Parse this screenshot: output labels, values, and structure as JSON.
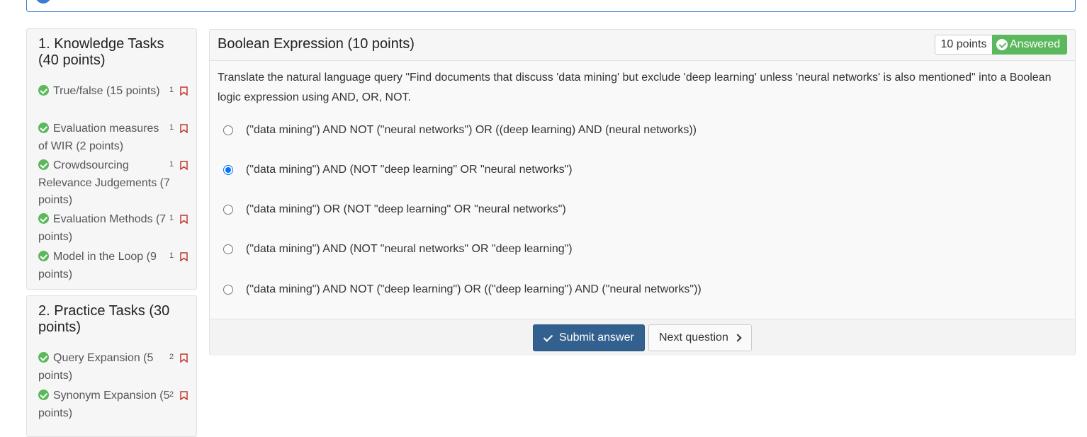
{
  "sidebar": {
    "sections": [
      {
        "title": "1. Knowledge Tasks (40 points)",
        "items": [
          {
            "label": "True/false (15 points)",
            "count": "1"
          },
          {
            "label": "Evaluation measures of WIR (2 points)",
            "count": "1"
          },
          {
            "label": "Crowdsourcing Relevance Judgements (7 points)",
            "count": "1"
          },
          {
            "label": "Evaluation Methods (7 points)",
            "count": "1"
          },
          {
            "label": "Model in the Loop (9 points)",
            "count": "1"
          }
        ]
      },
      {
        "title": "2. Practice Tasks (30 points)",
        "items": [
          {
            "label": "Query Expansion (5 points)",
            "count": "2"
          },
          {
            "label": "Synonym Expansion (5 points)",
            "count": "2"
          }
        ]
      }
    ]
  },
  "question": {
    "title": "Boolean Expression (10 points)",
    "points_badge": "10 points",
    "status_badge": "Answered",
    "text": "Translate the natural language query \"Find documents that discuss 'data mining' but exclude 'deep learning' unless 'neural networks' is also mentioned\" into a Boolean logic expression using AND, OR, NOT.",
    "options": [
      {
        "label": "(\"data mining\") AND NOT (\"neural networks\") OR ((deep learning) AND (neural networks))",
        "selected": false
      },
      {
        "label": "(\"data mining\") AND (NOT \"deep learning\" OR \"neural networks\")",
        "selected": true
      },
      {
        "label": "(\"data mining\") OR (NOT \"deep learning\" OR \"neural networks\")",
        "selected": false
      },
      {
        "label": "(\"data mining\") AND (NOT \"neural networks\" OR \"deep learning\")",
        "selected": false
      },
      {
        "label": "(\"data mining\") AND NOT (\"deep learning\") OR ((\"deep learning\") AND (\"neural networks\"))",
        "selected": false
      }
    ],
    "submit_label": "Submit answer",
    "next_label": "Next question"
  },
  "colors": {
    "success": "#5cb85c",
    "primary": "#33618f",
    "bookmark": "#c0392b",
    "radio": "#0075ff"
  },
  "icons": {
    "item_status": "check-circle-icon",
    "bookmark": "bookmark-icon",
    "submit": "check-icon",
    "next": "chevron-right-icon"
  }
}
